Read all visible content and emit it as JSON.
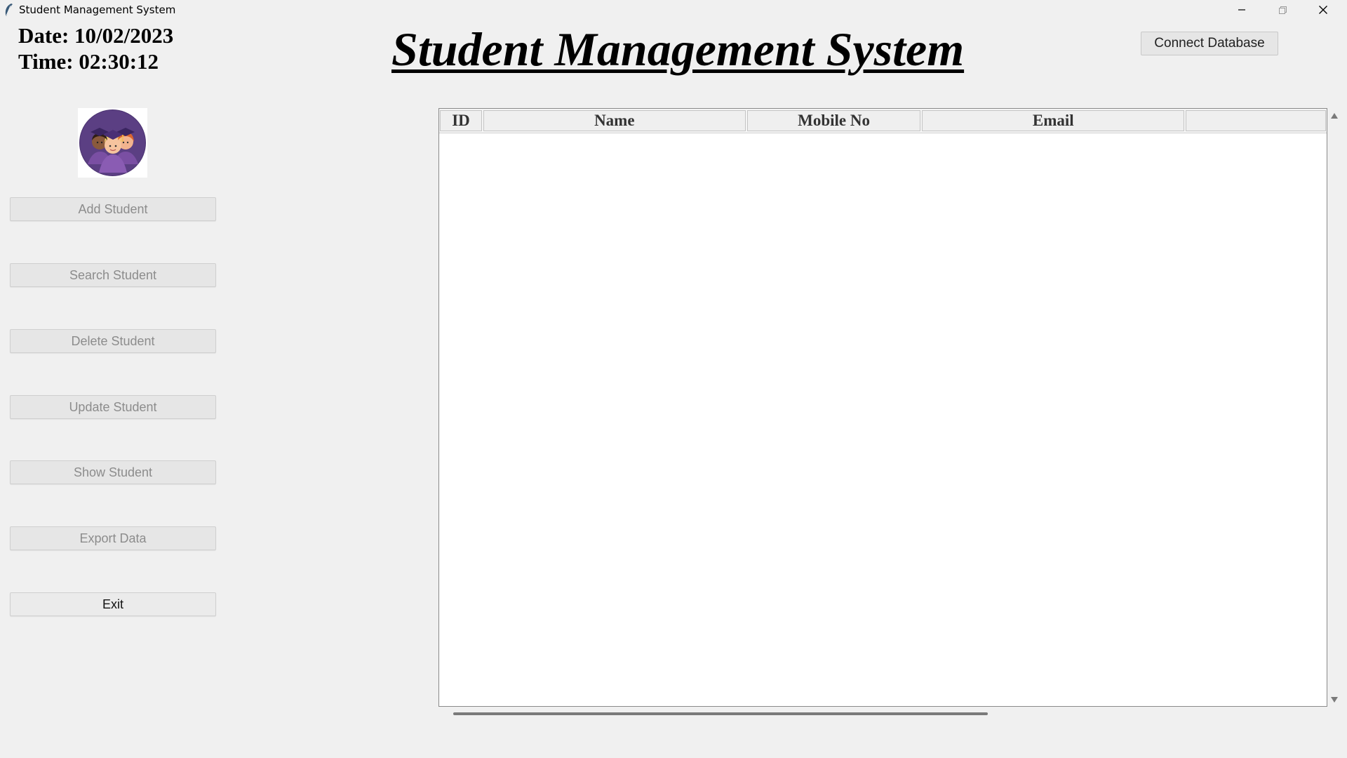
{
  "window": {
    "title": "Student Management System",
    "icon": "feather-icon"
  },
  "clock": {
    "date_text": "Date: 10/02/2023",
    "time_text": "Time: 02:30:12"
  },
  "header": {
    "title": "Student Management System",
    "connect_label": "Connect Database"
  },
  "sidebar": {
    "logo": "students-graduation-logo",
    "buttons": [
      {
        "label": "Add Student",
        "enabled": false
      },
      {
        "label": "Search Student",
        "enabled": false
      },
      {
        "label": "Delete Student",
        "enabled": false
      },
      {
        "label": "Update Student",
        "enabled": false
      },
      {
        "label": "Show Student",
        "enabled": false
      },
      {
        "label": "Export Data",
        "enabled": false
      },
      {
        "label": "Exit",
        "enabled": true
      }
    ]
  },
  "table": {
    "columns": [
      "ID",
      "Name",
      "Mobile No",
      "Email",
      ""
    ],
    "rows": []
  },
  "colors": {
    "background": "#f0f0f0",
    "disabled_text": "#8c8c8c",
    "logo_purple": "#6b3d8a"
  }
}
